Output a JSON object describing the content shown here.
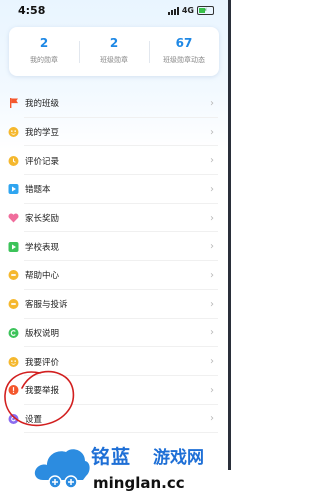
{
  "status_bar": {
    "time": "4:58",
    "network": "4G"
  },
  "stats": [
    {
      "value": "2",
      "label": "我的勋章"
    },
    {
      "value": "2",
      "label": "班级勋章"
    },
    {
      "value": "67",
      "label": "班级勋章动态"
    }
  ],
  "menu": [
    {
      "label": "我的班级",
      "icon": "flag-icon",
      "color": "#f4572d"
    },
    {
      "label": "我的学豆",
      "icon": "bean-icon",
      "color": "#f5b82e"
    },
    {
      "label": "评价记录",
      "icon": "record-icon",
      "color": "#f5b82e"
    },
    {
      "label": "错题本",
      "icon": "book-icon",
      "color": "#2fa5f0"
    },
    {
      "label": "家长奖励",
      "icon": "heart-icon",
      "color": "#f06d9c"
    },
    {
      "label": "学校表现",
      "icon": "play-icon",
      "color": "#3cc35a"
    },
    {
      "label": "帮助中心",
      "icon": "help-icon",
      "color": "#f5b82e"
    },
    {
      "label": "客服与投诉",
      "icon": "service-icon",
      "color": "#f5b82e"
    },
    {
      "label": "版权说明",
      "icon": "copyright-icon",
      "color": "#3cc35a"
    },
    {
      "label": "我要评价",
      "icon": "rate-icon",
      "color": "#f5b82e"
    },
    {
      "label": "我要举报",
      "icon": "report-icon",
      "color": "#f4572d"
    },
    {
      "label": "设置",
      "icon": "settings-icon",
      "color": "#8a6cf0"
    }
  ],
  "watermark": {
    "name": "铭蓝",
    "subtitle": "游戏网",
    "url": "minglan.cc"
  },
  "colors": {
    "accent": "#1e88e5",
    "annotation": "#d21f1f"
  }
}
